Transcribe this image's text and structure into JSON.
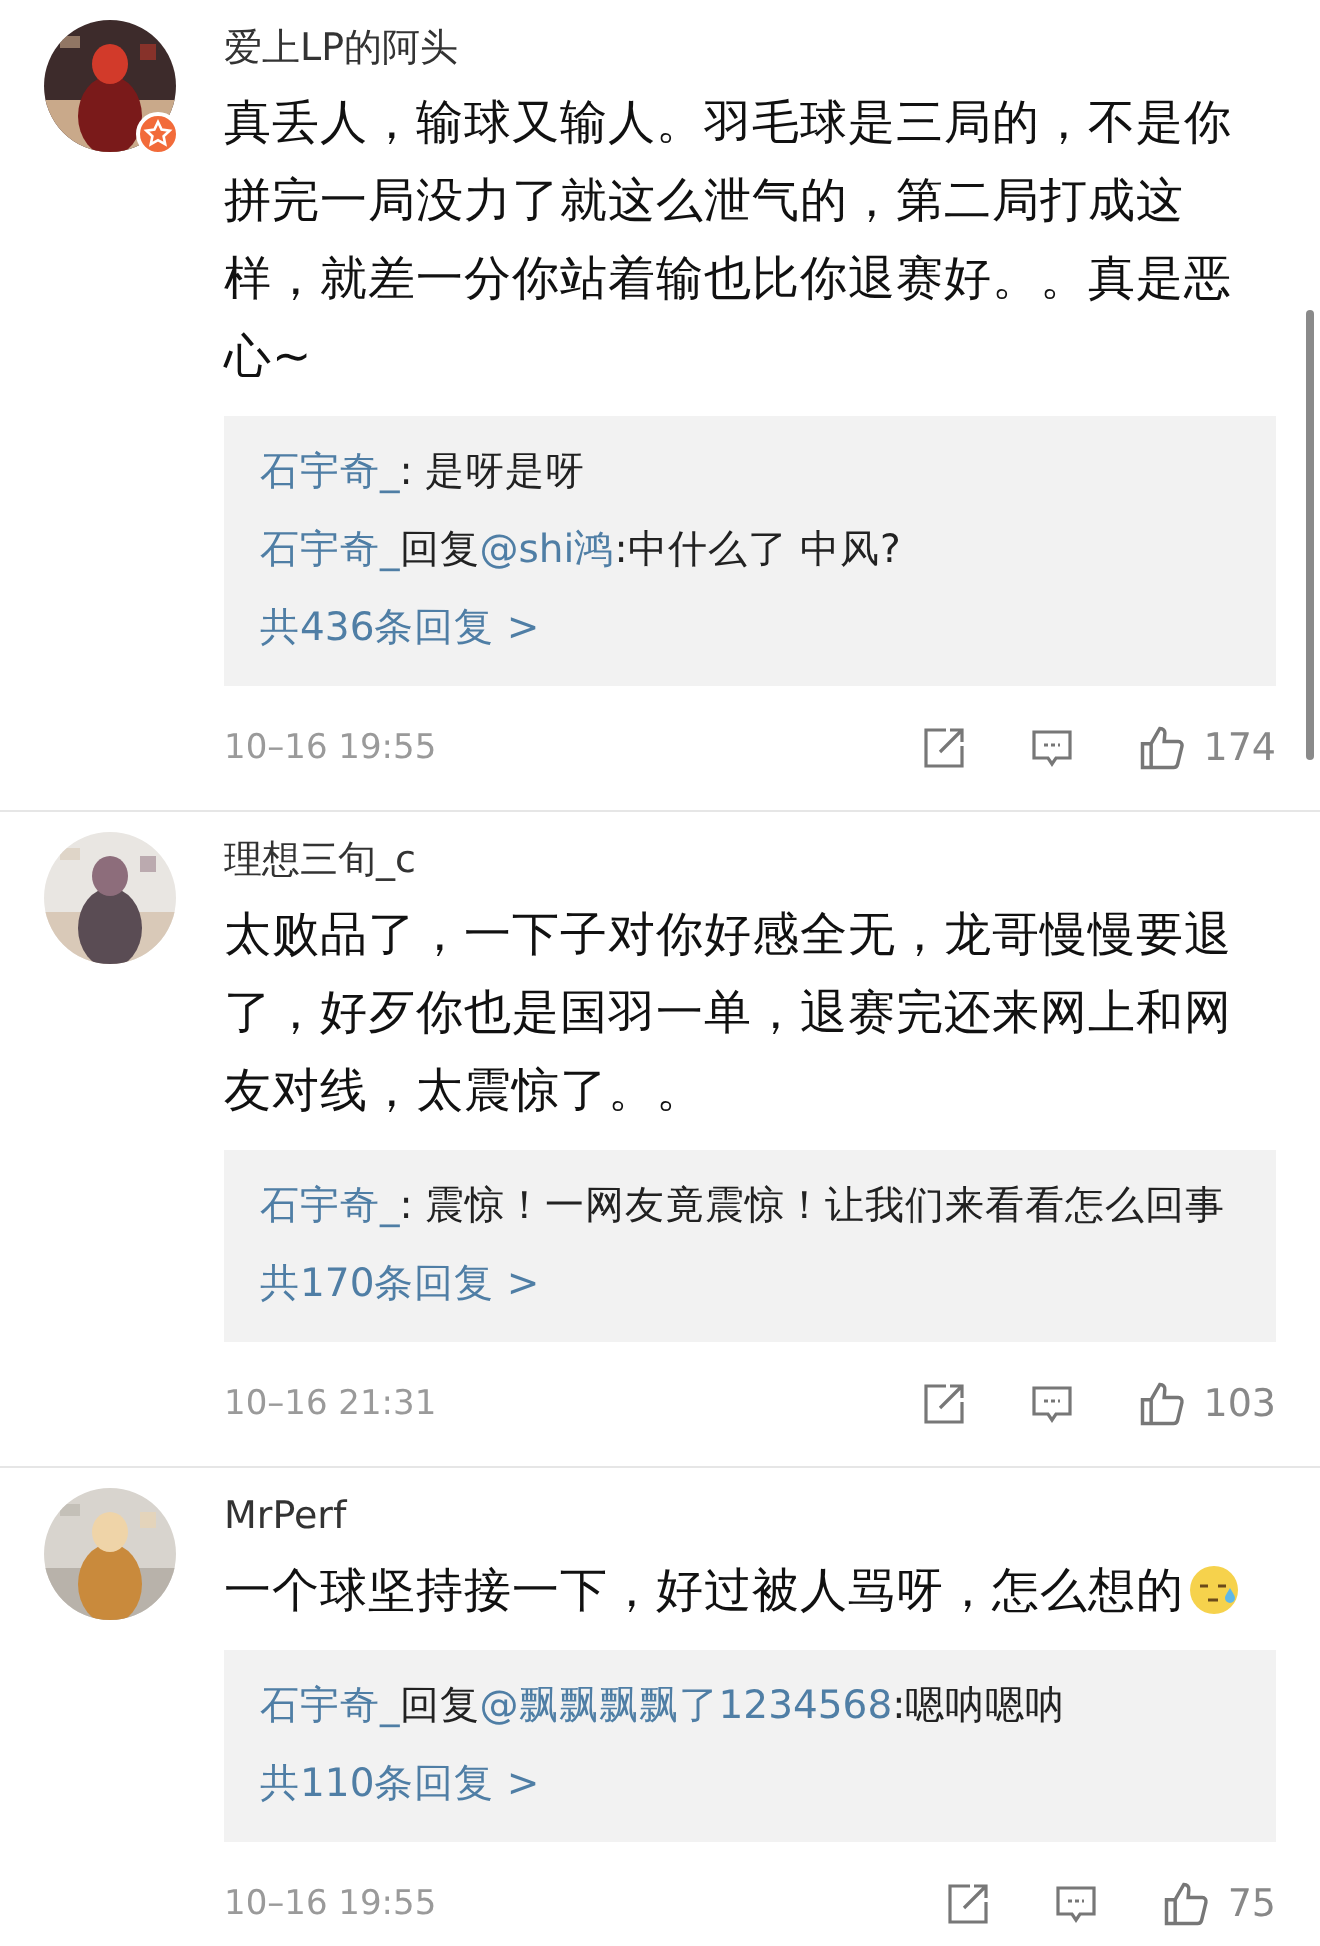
{
  "comments": [
    {
      "user": "爱上LP的阿头",
      "verified": true,
      "avatar": {
        "kind": "picture"
      },
      "text": "真丢人，输球又输人。羽毛球是三局的，不是你拼完一局没力了就这么泄气的，第二局打成这样，就差一分你站着输也比你退赛好。。真是恶心~",
      "emoji": false,
      "replies": [
        [
          {
            "kind": "user",
            "text": "石宇奇_"
          },
          {
            "kind": "plain",
            "text": ": 是呀是呀"
          }
        ],
        [
          {
            "kind": "user",
            "text": "石宇奇_"
          },
          {
            "kind": "plain",
            "text": "回复"
          },
          {
            "kind": "user",
            "text": "@shi鸿"
          },
          {
            "kind": "plain",
            "text": ":中什么了 中风?"
          }
        ]
      ],
      "more": "共436条回复 >",
      "time": "10–16 19:55",
      "likes": "174"
    },
    {
      "user": "理想三旬_c",
      "verified": false,
      "avatar": {
        "kind": "picture"
      },
      "text": "太败品了，一下子对你好感全无，龙哥慢慢要退了，好歹你也是国羽一单，退赛完还来网上和网友对线，太震惊了。。",
      "emoji": false,
      "replies": [
        [
          {
            "kind": "user",
            "text": "石宇奇_"
          },
          {
            "kind": "plain",
            "text": ": 震惊！一网友竟震惊！让我们来看看怎么回事"
          }
        ]
      ],
      "more": "共170条回复 >",
      "time": "10–16 21:31",
      "likes": "103"
    },
    {
      "user": "MrPerf",
      "verified": false,
      "avatar": {
        "kind": "picture"
      },
      "text": "一个球坚持接一下，好过被人骂呀，怎么想的",
      "emoji": true,
      "replies": [
        [
          {
            "kind": "user",
            "text": "石宇奇_"
          },
          {
            "kind": "plain",
            "text": "回复"
          },
          {
            "kind": "user",
            "text": "@飘飘飘飘了1234568"
          },
          {
            "kind": "plain",
            "text": ":嗯呐嗯呐"
          }
        ]
      ],
      "more": "共110条回复 >",
      "time": "10–16 19:55",
      "likes": "75"
    }
  ]
}
